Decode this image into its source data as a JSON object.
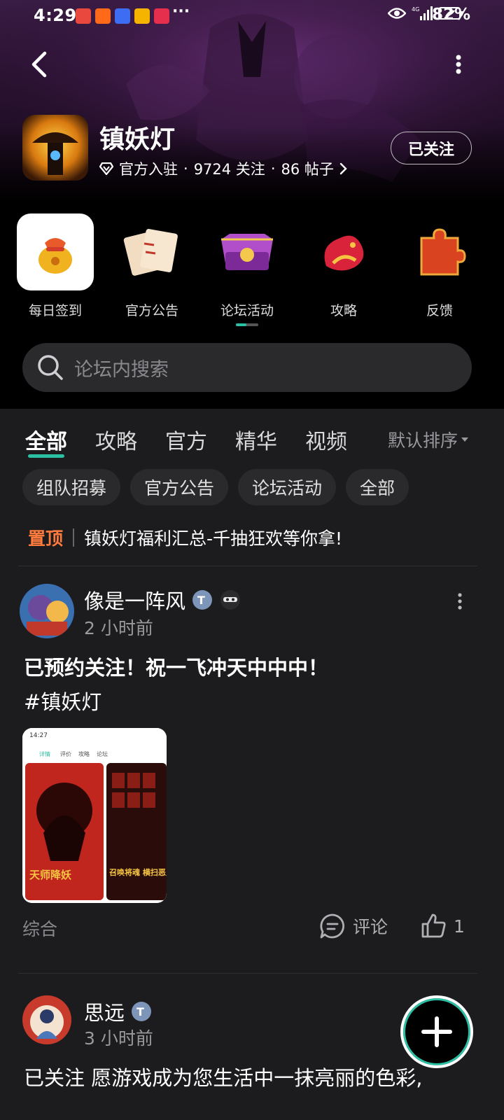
{
  "status_bar": {
    "time": "4:29",
    "battery": "82%",
    "network": "4G"
  },
  "header": {
    "game_name": "镇妖灯",
    "badge": "官方入驻",
    "followers": "9724 关注",
    "posts": "86 帖子",
    "follow_label": "已关注"
  },
  "quick_links": [
    {
      "label": "每日签到"
    },
    {
      "label": "官方公告"
    },
    {
      "label": "论坛活动"
    },
    {
      "label": "攻略"
    },
    {
      "label": "反馈"
    }
  ],
  "search": {
    "placeholder": "论坛内搜索"
  },
  "tabs": [
    "全部",
    "攻略",
    "官方",
    "精华",
    "视频"
  ],
  "sort_label": "默认排序",
  "chips": [
    "组队招募",
    "官方公告",
    "论坛活动",
    "全部"
  ],
  "pinned": {
    "tag": "置顶",
    "title": "镇妖灯福利汇总-千抽狂欢等你拿!"
  },
  "posts": [
    {
      "author": "像是一阵风",
      "time": "2 小时前",
      "body": "已预约关注！祝一飞冲天中中中！",
      "tag": "#镇妖灯",
      "category": "综合",
      "comment_label": "评论",
      "likes": "1",
      "thumb": {
        "time": "14:27",
        "tabs": [
          "详情",
          "评价",
          "攻略",
          "论坛"
        ],
        "banner_left": "天师降妖",
        "banner_right": "召唤将魂 横扫恶鬼"
      }
    },
    {
      "author": "思远",
      "time": "3 小时前",
      "body": "已关注 愿游戏成为您生活中一抹亮丽的色彩,"
    }
  ],
  "colors": {
    "accent": "#2bbfa4",
    "pinned": "#ff7a3d"
  }
}
